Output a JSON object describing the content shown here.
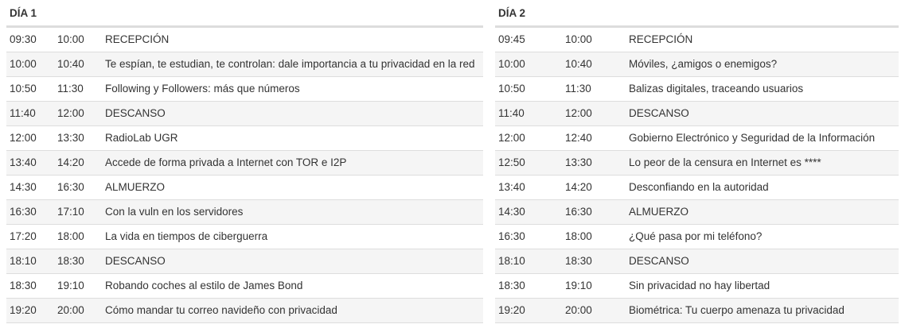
{
  "day1": {
    "title": "DÍA 1",
    "rows": [
      {
        "start": "09:30",
        "end": "10:00",
        "title": "RECEPCIÓN"
      },
      {
        "start": "10:00",
        "end": "10:40",
        "title": "Te espían, te estudian, te controlan: dale importancia a tu privacidad en la red"
      },
      {
        "start": "10:50",
        "end": "11:30",
        "title": "Following y Followers: más que números"
      },
      {
        "start": "11:40",
        "end": "12:00",
        "title": "DESCANSO"
      },
      {
        "start": "12:00",
        "end": "13:30",
        "title": "RadioLab UGR"
      },
      {
        "start": "13:40",
        "end": "14:20",
        "title": "Accede de forma privada a Internet con TOR e I2P"
      },
      {
        "start": "14:30",
        "end": "16:30",
        "title": "ALMUERZO"
      },
      {
        "start": "16:30",
        "end": "17:10",
        "title": "Con la vuln en los servidores"
      },
      {
        "start": "17:20",
        "end": "18:00",
        "title": "La vida en tiempos de ciberguerra"
      },
      {
        "start": "18:10",
        "end": "18:30",
        "title": "DESCANSO"
      },
      {
        "start": "18:30",
        "end": "19:10",
        "title": "Robando coches al estilo de James Bond"
      },
      {
        "start": "19:20",
        "end": "20:00",
        "title": "Cómo mandar tu correo navideño con privacidad"
      }
    ]
  },
  "day2": {
    "title": "DÍA 2",
    "rows": [
      {
        "start": "09:45",
        "end": "10:00",
        "title": "RECEPCIÓN"
      },
      {
        "start": "10:00",
        "end": "10:40",
        "title": "Móviles, ¿amigos o enemigos?"
      },
      {
        "start": "10:50",
        "end": "11:30",
        "title": "Balizas digitales, traceando usuarios"
      },
      {
        "start": "11:40",
        "end": "12:00",
        "title": "DESCANSO"
      },
      {
        "start": "12:00",
        "end": "12:40",
        "title": "Gobierno Electrónico y Seguridad de la Información"
      },
      {
        "start": "12:50",
        "end": "13:30",
        "title": "Lo peor de la censura en Internet es ****"
      },
      {
        "start": "13:40",
        "end": "14:20",
        "title": "Desconfiando en la autoridad"
      },
      {
        "start": "14:30",
        "end": "16:30",
        "title": "ALMUERZO"
      },
      {
        "start": "16:30",
        "end": "18:00",
        "title": "¿Qué pasa por mi teléfono?"
      },
      {
        "start": "18:10",
        "end": "18:30",
        "title": "DESCANSO"
      },
      {
        "start": "18:30",
        "end": "19:10",
        "title": "Sin privacidad no hay libertad"
      },
      {
        "start": "19:20",
        "end": "20:00",
        "title": "Biométrica: Tu cuerpo amenaza tu privacidad"
      }
    ]
  }
}
